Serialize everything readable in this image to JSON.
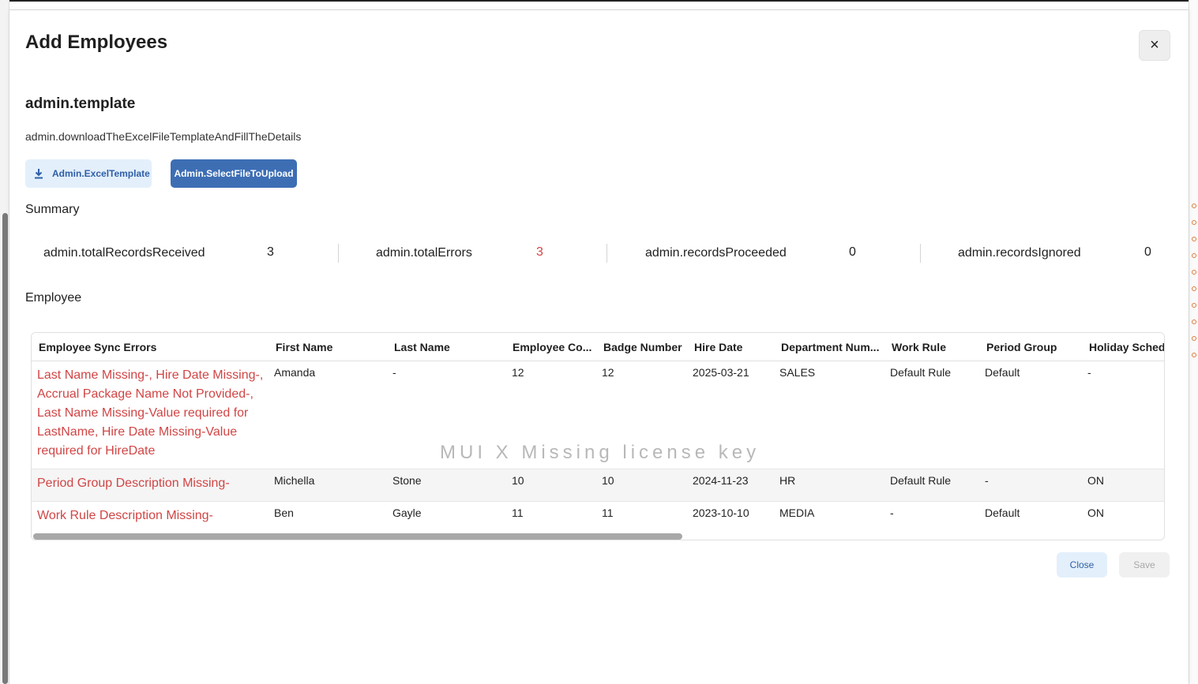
{
  "dialog": {
    "title": "Add Employees",
    "close_icon": "×"
  },
  "template": {
    "heading": "admin.template",
    "description": "admin.downloadTheExcelFileTemplateAndFillTheDetails",
    "download_label": "Admin.ExcelTemplate",
    "upload_label": "Admin.SelectFileToUpload"
  },
  "summary": {
    "label": "Summary",
    "items": [
      {
        "label": "admin.totalRecordsReceived",
        "value": "3"
      },
      {
        "label": "admin.totalErrors",
        "value": "3"
      },
      {
        "label": "admin.recordsProceeded",
        "value": "0"
      },
      {
        "label": "admin.recordsIgnored",
        "value": "0"
      }
    ]
  },
  "employee": {
    "label": "Employee",
    "watermark": "MUI X Missing license key",
    "columns": [
      "Employee Sync Errors",
      "First Name",
      "Last Name",
      "Employee Co...",
      "Badge Number",
      "Hire Date",
      "Department Num...",
      "Work Rule",
      "Period Group",
      "Holiday Schedu"
    ],
    "rows": [
      {
        "error": "Last Name Missing-, Hire Date Missing-, Accrual Package Name Not Provided-, Last Name Missing-Value required for LastName, Hire Date Missing-Value required for HireDate",
        "first": "Amanda",
        "last": "-",
        "code": "12",
        "badge": "12",
        "hire": "2025-03-21",
        "dept": "SALES",
        "rule": "Default Rule",
        "period": "Default",
        "holiday": "-"
      },
      {
        "error": "Period Group Description Missing-",
        "first": "Michella",
        "last": "Stone",
        "code": "10",
        "badge": "10",
        "hire": "2024-11-23",
        "dept": "HR",
        "rule": "Default Rule",
        "period": "-",
        "holiday": "ON"
      },
      {
        "error": "Work Rule Description Missing-",
        "first": "Ben",
        "last": "Gayle",
        "code": "11",
        "badge": "11",
        "hire": "2023-10-10",
        "dept": "MEDIA",
        "rule": "-",
        "period": "Default",
        "holiday": "ON"
      }
    ]
  },
  "footer": {
    "close_label": "Close",
    "save_label": "Save"
  },
  "colors": {
    "accent": "#3d6eb4",
    "error": "#d14545",
    "light_button": "#e3effb"
  }
}
